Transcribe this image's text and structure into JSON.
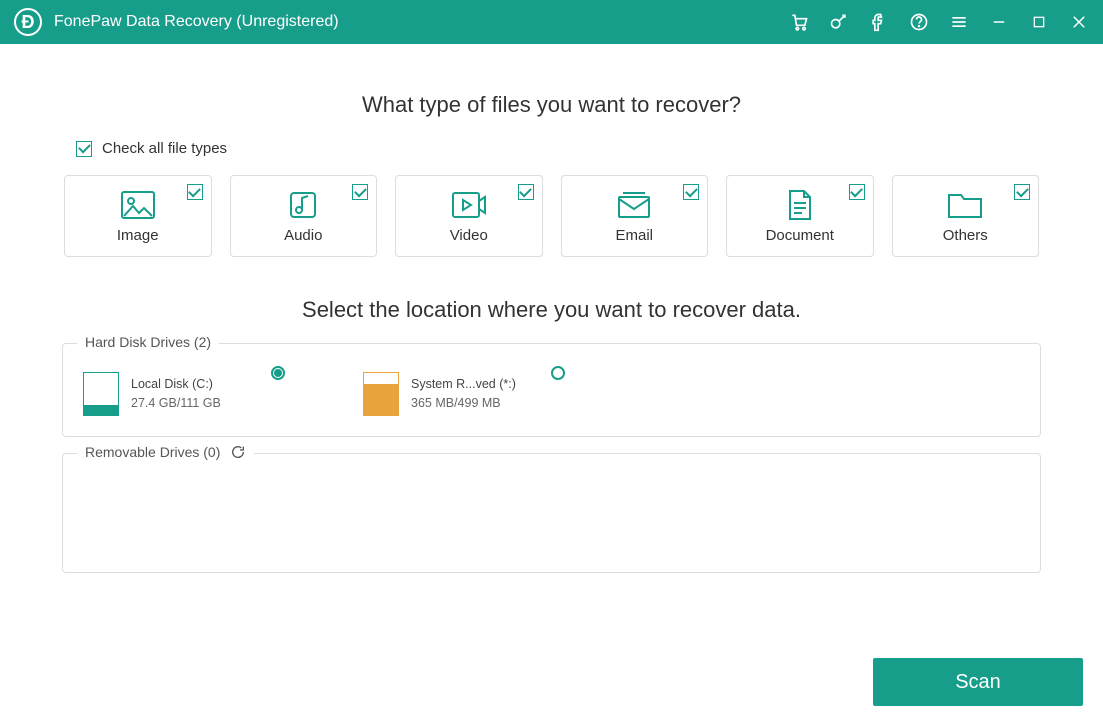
{
  "app": {
    "title": "FonePaw Data Recovery (Unregistered)"
  },
  "headings": {
    "files_heading": "What type of files you want to recover?",
    "location_heading": "Select the location where you want to recover data."
  },
  "check_all_label": "Check all file types",
  "file_types": {
    "image": "Image",
    "audio": "Audio",
    "video": "Video",
    "email": "Email",
    "document": "Document",
    "others": "Others"
  },
  "sections": {
    "hard_disk_label": "Hard Disk Drives (2)",
    "removable_label": "Removable Drives (0)"
  },
  "drives": {
    "c": {
      "name": "Local Disk (C:)",
      "size": "27.4 GB/111 GB"
    },
    "reserved": {
      "name": "System R...ved (*:)",
      "size": "365 MB/499 MB"
    }
  },
  "scan_label": "Scan"
}
